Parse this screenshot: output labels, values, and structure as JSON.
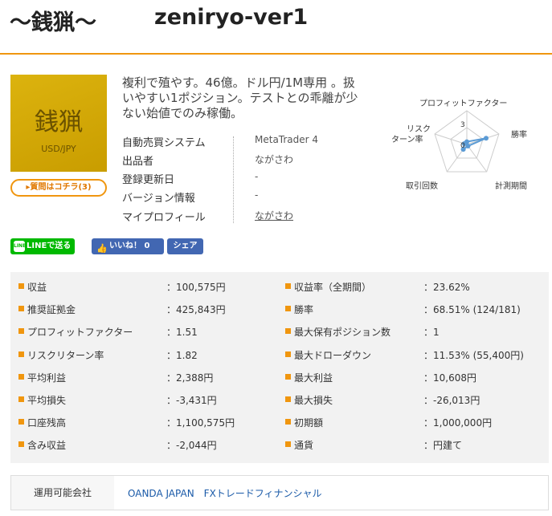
{
  "header": {
    "name": "〜銭猟〜",
    "version": "zeniryo-ver1"
  },
  "thumbnail": {
    "kanji": "銭猟",
    "pair": "USD/JPY"
  },
  "ask_button": "質問はコチラ(3)",
  "description": "複利で殖やす。46億。ドル円/1M専用 。扱いやすい1ポジション。テストとの乖離が少ない始値でのみ稼働。",
  "info": [
    {
      "key": "自動売買システム",
      "value": "MetaTrader 4"
    },
    {
      "key": "出品者",
      "value": "ながさわ"
    },
    {
      "key": "登録更新日",
      "value": "-"
    },
    {
      "key": "バージョン情報",
      "value": "-"
    },
    {
      "key": "マイプロフィール",
      "value": "ながさわ"
    }
  ],
  "radar": {
    "labels": {
      "top": "プロフィットファクター",
      "right": "勝率",
      "bottom_right": "計測期間",
      "bottom_left": "取引回数",
      "left_line1": "リスク",
      "left_line2": "ターン率"
    },
    "scale_label": "3",
    "zero_label": "0",
    "values": [
      0.4,
      3.0,
      0.3,
      0.9,
      0.4
    ],
    "max": 5,
    "color": "#5b9bd5"
  },
  "social": {
    "line": "LINEで送る",
    "like": "いいね！ 0",
    "share": "シェア"
  },
  "stats_left": [
    {
      "key": "収益",
      "value": "：100,575円"
    },
    {
      "key": "推奨証拠金",
      "value": "：425,843円"
    },
    {
      "key": "プロフィットファクター",
      "value": "：1.51"
    },
    {
      "key": "リスクリターン率",
      "value": "：1.82"
    },
    {
      "key": "平均利益",
      "value": "：2,388円"
    },
    {
      "key": "平均損失",
      "value": "：-3,431円"
    },
    {
      "key": "口座残高",
      "value": "：1,100,575円"
    },
    {
      "key": "含み収益",
      "value": "：-2,044円"
    }
  ],
  "stats_right": [
    {
      "key": "収益率（全期間）",
      "value": "：23.62%"
    },
    {
      "key": "勝率",
      "value": "：68.51% (124/181)"
    },
    {
      "key": "最大保有ポジション数",
      "value": "：1"
    },
    {
      "key": "最大ドローダウン",
      "value": "：11.53% (55,400円)"
    },
    {
      "key": "最大利益",
      "value": "：10,608円"
    },
    {
      "key": "最大損失",
      "value": "：-26,013円"
    },
    {
      "key": "初期額",
      "value": "：1,000,000円"
    },
    {
      "key": "通貨",
      "value": "：円建て"
    }
  ],
  "company": {
    "key": "運用可能会社",
    "value": "OANDA JAPAN　FXトレードフィナンシャル"
  }
}
